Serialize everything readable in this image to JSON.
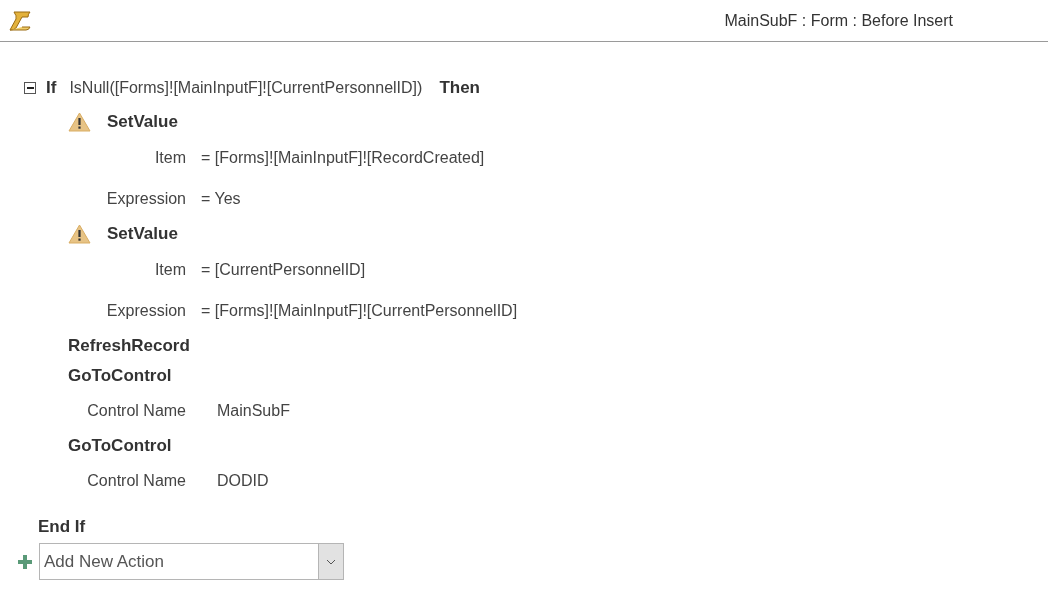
{
  "header": {
    "title": "MainSubF : Form : Before Insert"
  },
  "if_block": {
    "expanded": true,
    "keyword": "If",
    "condition": "IsNull([Forms]![MainInputF]![CurrentPersonnelID])",
    "then": "Then",
    "end": "End If",
    "actions": [
      {
        "kind": "warning",
        "name": "SetValue",
        "arguments": [
          {
            "label": "Item",
            "value": "= [Forms]![MainInputF]![RecordCreated]"
          },
          {
            "label": "Expression",
            "value": "= Yes"
          }
        ]
      },
      {
        "kind": "warning",
        "name": "SetValue",
        "arguments": [
          {
            "label": "Item",
            "value": "= [CurrentPersonnelID]"
          },
          {
            "label": "Expression",
            "value": "= [Forms]![MainInputF]![CurrentPersonnelID]"
          }
        ]
      },
      {
        "kind": "plain",
        "name": "RefreshRecord"
      },
      {
        "kind": "plain",
        "name": "GoToControl",
        "arguments": [
          {
            "label": "Control Name",
            "value": "MainSubF"
          }
        ]
      },
      {
        "kind": "plain",
        "name": "GoToControl",
        "arguments": [
          {
            "label": "Control Name",
            "value": "DODID"
          }
        ]
      }
    ]
  },
  "add_action": {
    "placeholder": "Add New Action"
  }
}
